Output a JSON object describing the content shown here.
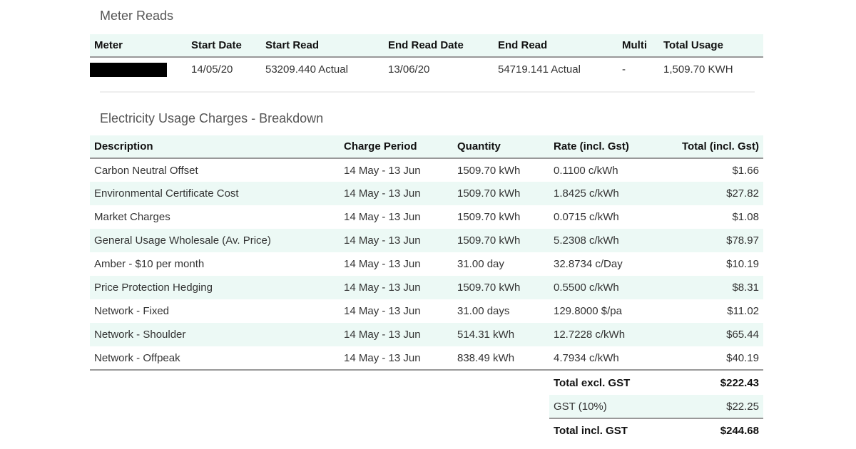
{
  "meter_reads": {
    "title": "Meter Reads",
    "columns": [
      "Meter",
      "Start Date",
      "Start Read",
      "End Read Date",
      "End Read",
      "Multi",
      "Total Usage"
    ],
    "rows": [
      {
        "meter": "",
        "start_date": "14/05/20",
        "start_read": "53209.440 Actual",
        "end_read_date": "13/06/20",
        "end_read": "54719.141 Actual",
        "multi": "-",
        "total_usage": "1,509.70 KWH"
      }
    ]
  },
  "charges": {
    "title": "Electricity Usage Charges - Breakdown",
    "columns": [
      "Description",
      "Charge Period",
      "Quantity",
      "Rate (incl. Gst)",
      "Total (incl. Gst)"
    ],
    "rows": [
      {
        "description": "Carbon Neutral Offset",
        "period": "14 May - 13 Jun",
        "quantity": "1509.70 kWh",
        "rate": "0.1100 c/kWh",
        "total": "$1.66"
      },
      {
        "description": "Environmental Certificate Cost",
        "period": "14 May - 13 Jun",
        "quantity": "1509.70 kWh",
        "rate": "1.8425 c/kWh",
        "total": "$27.82"
      },
      {
        "description": "Market Charges",
        "period": "14 May - 13 Jun",
        "quantity": "1509.70 kWh",
        "rate": "0.0715 c/kWh",
        "total": "$1.08"
      },
      {
        "description": "General Usage Wholesale (Av. Price)",
        "period": "14 May - 13 Jun",
        "quantity": "1509.70 kWh",
        "rate": "5.2308 c/kWh",
        "total": "$78.97"
      },
      {
        "description": "Amber - $10 per month",
        "period": "14 May - 13 Jun",
        "quantity": "31.00 day",
        "rate": "32.8734 c/Day",
        "total": "$10.19"
      },
      {
        "description": "Price Protection Hedging",
        "period": "14 May - 13 Jun",
        "quantity": "1509.70 kWh",
        "rate": "0.5500 c/kWh",
        "total": "$8.31"
      },
      {
        "description": "Network - Fixed",
        "period": "14 May - 13 Jun",
        "quantity": "31.00 days",
        "rate": "129.8000 $/pa",
        "total": "$11.02"
      },
      {
        "description": "Network - Shoulder",
        "period": "14 May - 13 Jun",
        "quantity": "514.31 kWh",
        "rate": "12.7228 c/kWh",
        "total": "$65.44"
      },
      {
        "description": "Network - Offpeak",
        "period": "14 May - 13 Jun",
        "quantity": "838.49 kWh",
        "rate": "4.7934 c/kWh",
        "total": "$40.19"
      }
    ]
  },
  "totals": {
    "excl_label": "Total excl. GST",
    "excl_value": "$222.43",
    "gst_label": "GST (10%)",
    "gst_value": "$22.25",
    "incl_label": "Total incl. GST",
    "incl_value": "$244.68"
  },
  "colors": {
    "header_bg": "#ecf9f5",
    "stripe_bg": "#ecf9f5",
    "rule": "#999999"
  }
}
